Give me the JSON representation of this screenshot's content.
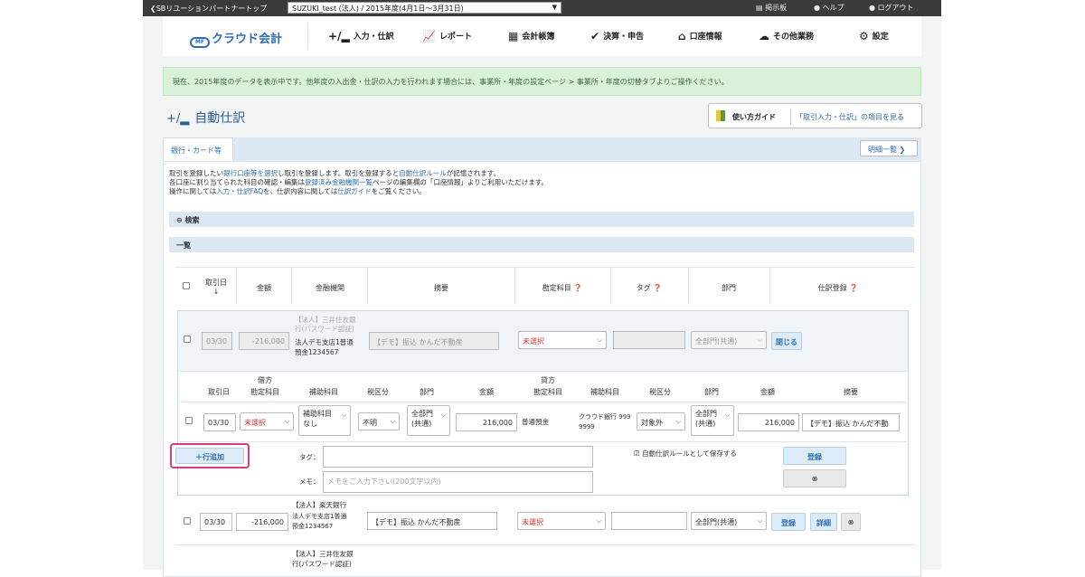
{
  "topbar": {
    "back_link": "❮SBリユーションパートナートップ",
    "office_selector": "SUZUKI_test (法人) / 2015年度(4月1日〜3月31日)",
    "notice": "掲示板",
    "help": "ヘルプ",
    "logout": "ログアウト"
  },
  "nav": {
    "logo": "クラウド会計",
    "logo_mark": "MF",
    "items": [
      "入力・仕訳",
      "レポート",
      "会計帳簿",
      "決算・申告",
      "口座情報",
      "その他業務",
      "設定"
    ]
  },
  "info_bar": "現在、2015年度のデータを表示中です。他年度の入出金・仕訳の入力を行われます場合には、事業所・年度の設定ページ > 事業所・年度の切替タブよりご操作ください。",
  "page": {
    "title": "自動仕訳",
    "guide_title": "使い方ガイド",
    "guide_link": "「取引入力・仕訳」の項目を見る"
  },
  "tabs": {
    "bank_card": "銀行・カード等",
    "detail_list": "明細一覧 ❯"
  },
  "desc": {
    "l1a": "取引を登録したい",
    "l1b": "銀行口座等を選択",
    "l1c": "し取引を登録します。取引を登録すると",
    "l1d": "自動仕訳ルール",
    "l1e": "が記憶されます。",
    "l2a": "各口座に割り当てられた科目の確認・編集は",
    "l2b": "登録済み金融機関一覧",
    "l2c": "ページの編集欄の「口座情報」よりご利用いただけます。",
    "l3a": "操作に関しては",
    "l3b": "入力・仕訳FAQ",
    "l3c": "を、仕訳内容に関しては",
    "l3d": "仕訳ガイド",
    "l3e": "をご覧ください。"
  },
  "sections": {
    "search": "検索",
    "list": "一覧"
  },
  "table_headers": {
    "date": "取引日",
    "amount": "金額",
    "institution": "金融機関",
    "memo": "摘要",
    "account": "勘定科目",
    "tag": "タグ",
    "department": "部門",
    "register": "仕訳登録"
  },
  "row1": {
    "date": "03/30",
    "amount": "-216,000",
    "bank_l1": "【法人】三井住友銀",
    "bank_l2": "行(パスワード認証)",
    "bank_l3": "法人デモ支店1普通",
    "bank_l4": "預金1234567",
    "memo": "【デモ】振込 かんだ不動産",
    "account": "未選択",
    "dept": "全部門(共通)",
    "close": "閉じる"
  },
  "journal_headers": {
    "debit": "借方",
    "credit": "貸方",
    "date": "取引日",
    "account": "勘定科目",
    "sub": "補助科目",
    "tax": "税区分",
    "dept": "部門",
    "amount": "金額",
    "memo": "摘要"
  },
  "journal": {
    "date": "03/30",
    "debit_account": "未選択",
    "debit_sub": "補助科目",
    "debit_sub2": "なし",
    "debit_tax": "不明",
    "debit_dept": "全部門",
    "debit_dept2": "(共通)",
    "debit_amount": "216,000",
    "credit_account": "普通預金",
    "credit_sub1": "クラウド銀行 999",
    "credit_sub2": "9999",
    "credit_tax": "対象外",
    "credit_dept": "全部門",
    "credit_dept2": "(共通)",
    "credit_amount": "216,000",
    "memo": "【デモ】振込 かんだ不動"
  },
  "form": {
    "add_row": "＋行追加",
    "tag_label": "タグ：",
    "memo_label": "メモ：",
    "memo_placeholder": "メモをご入力下さい(200文字以内)",
    "save_rule": "自動仕訳ルールとして保存する",
    "register": "登録",
    "cancel": "⊗"
  },
  "row2": {
    "date": "03/30",
    "amount": "-216,000",
    "bank_l1": "【法人】楽天銀行",
    "bank_l2": "法人デモ支店1普通",
    "bank_l3": "預金1234567",
    "memo": "【デモ】振込 かんだ不動産",
    "account": "未選択",
    "dept": "全部門(共通)",
    "register": "登録",
    "detail": "詳細"
  },
  "row3": {
    "bank_l1": "【法人】三井住友銀",
    "bank_l2": "行(パスワード認証)"
  },
  "colors": {
    "accent": "#2f6fb3",
    "highlight": "#e0397a",
    "info_bg": "#d9f0d9"
  }
}
